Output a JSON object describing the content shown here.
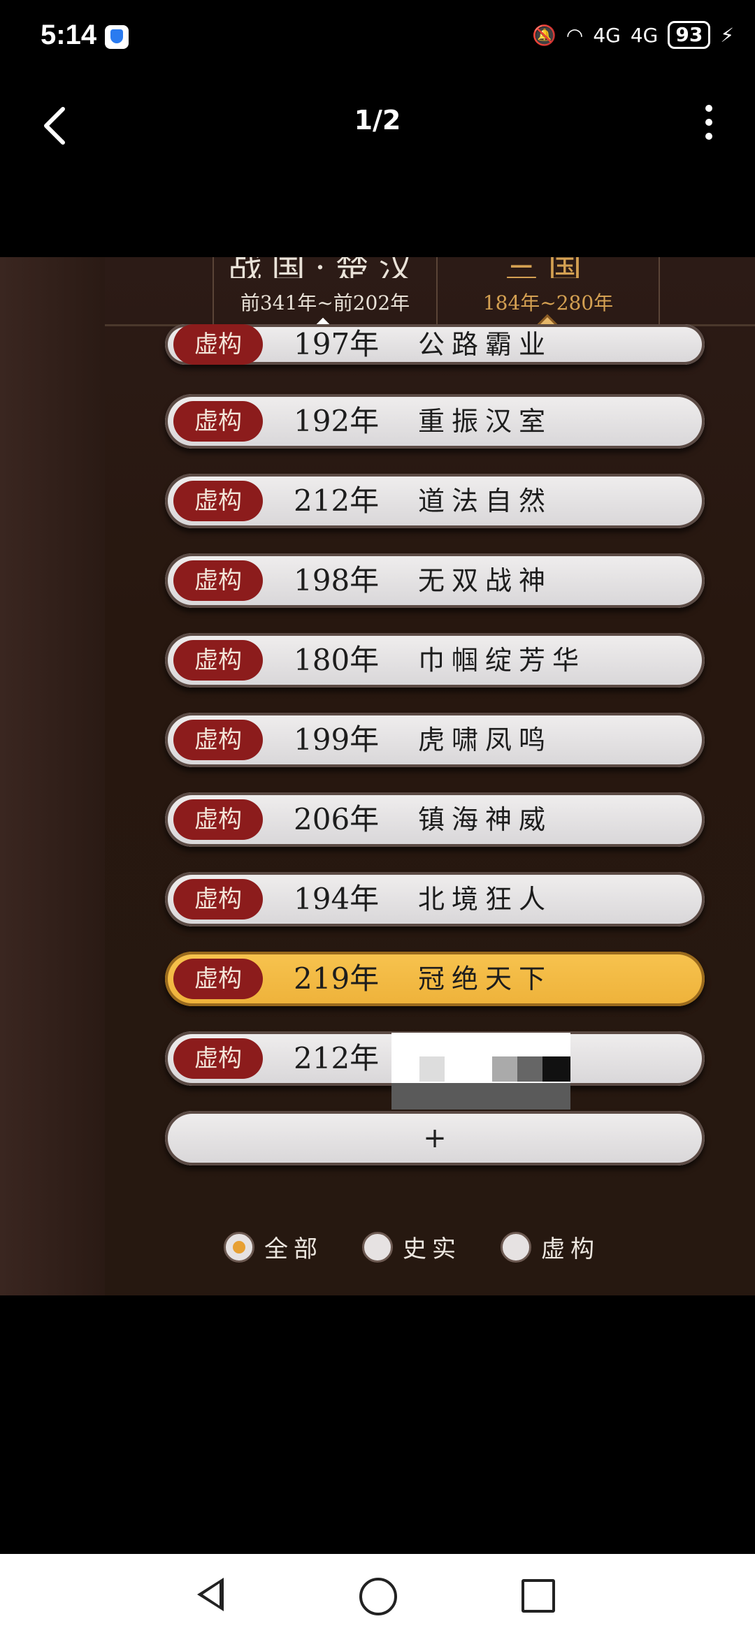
{
  "status_bar": {
    "time": "5:14",
    "battery": "93",
    "network_1": "4G",
    "network_2": "4G"
  },
  "header": {
    "title": "1/2"
  },
  "era_tabs": [
    {
      "name": "战国·楚汉",
      "range": "前341年~前202年"
    },
    {
      "name": "三国",
      "range": "184年~280年"
    }
  ],
  "list": [
    {
      "badge": "虚构",
      "year": "197年",
      "name": "公路霸业"
    },
    {
      "badge": "虚构",
      "year": "192年",
      "name": "重振汉室"
    },
    {
      "badge": "虚构",
      "year": "212年",
      "name": "道法自然"
    },
    {
      "badge": "虚构",
      "year": "198年",
      "name": "无双战神"
    },
    {
      "badge": "虚构",
      "year": "180年",
      "name": "巾帼绽芳华"
    },
    {
      "badge": "虚构",
      "year": "199年",
      "name": "虎啸凤鸣"
    },
    {
      "badge": "虚构",
      "year": "206年",
      "name": "镇海神威"
    },
    {
      "badge": "虚构",
      "year": "194年",
      "name": "北境狂人"
    },
    {
      "badge": "虚构",
      "year": "219年",
      "name": "冠绝天下"
    },
    {
      "badge": "虚构",
      "year": "212年",
      "name": ""
    }
  ],
  "add_label": "+",
  "filters": [
    {
      "label": "全部",
      "selected": true
    },
    {
      "label": "史实",
      "selected": false
    },
    {
      "label": "虚构",
      "selected": false
    }
  ],
  "colors": {
    "active_row": "#f7c34f",
    "badge": "#8c1c1c",
    "accent": "#e7b86a"
  }
}
